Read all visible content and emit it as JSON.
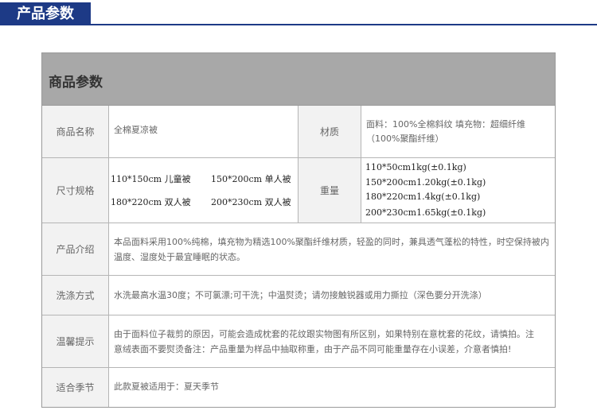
{
  "header": {
    "title": "产品参数"
  },
  "table": {
    "title": "商品参数",
    "name": {
      "label": "商品名称",
      "value": "全棉夏凉被"
    },
    "material": {
      "label": "材质",
      "line1": "面料：100%全棉斜纹  填充物：超细纤维",
      "line2": "（100%聚酯纤维）"
    },
    "size": {
      "label": "尺寸规格",
      "items": [
        "110*150cm 儿童被",
        "150*200cm 单人被",
        "180*220cm 双人被",
        "200*230cm 双人被"
      ]
    },
    "weight": {
      "label": "重量",
      "items": [
        "110*50cm1kg(±0.1kg)",
        "150*200cm1.20kg(±0.1kg)",
        "180*220cm1.4kg(±0.1kg)",
        "200*230cm1.65kg(±0.1kg)"
      ]
    },
    "intro": {
      "label": "产品介绍",
      "line1": "本品面料采用100%纯棉，填充物为精选100%聚酯纤维材质，轻盈的同时，兼具透气蓬松的特性，时空保持被内",
      "line2": "温度、湿度处于最宜睡眠的状态。"
    },
    "wash": {
      "label": "洗涤方式",
      "value": "水洗最高水温30度；不可氯漂;可干洗；中温熨烫；请勿接触锐器或用力撕拉（深色要分开洗涤）"
    },
    "tips": {
      "label": "温馨提示",
      "line1": "由于面料位子裁剪的原因，可能会造成枕套的花纹跟实物图有所区别，如果特别在意枕套的花纹，请慎拍。注",
      "line2": "意绒表面不要熨烫备注：产品重量为样品中抽取称重，由于产品不同可能重量存在小误差，介意者慎拍!"
    },
    "season": {
      "label": "适合季节",
      "value": "此款夏被适用于：夏天季节"
    }
  }
}
